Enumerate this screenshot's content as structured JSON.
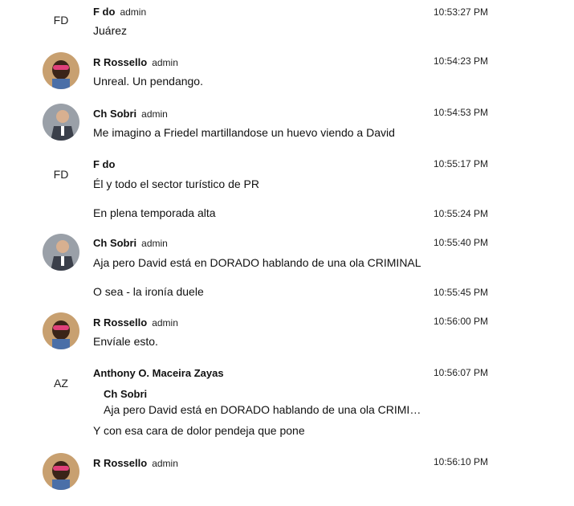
{
  "messages": [
    {
      "initials": "FD",
      "name": "F do",
      "role": "admin",
      "time": "10:53:27 PM",
      "text": "Juárez"
    },
    {
      "name": "R Rossello",
      "role": "admin",
      "time": "10:54:23 PM",
      "text": "Unreal. Un pendango."
    },
    {
      "name": "Ch Sobri",
      "role": "admin",
      "time": "10:54:53 PM",
      "text": "Me imagino a Friedel martillandose un huevo viendo a David"
    },
    {
      "initials": "FD",
      "name": "F do",
      "role": "admin",
      "time": "10:55:17 PM",
      "text": "Él y todo el sector turístico de PR"
    },
    {
      "time": "10:55:24 PM",
      "text": "En plena temporada alta"
    },
    {
      "name": "Ch Sobri",
      "role": "admin",
      "time": "10:55:40 PM",
      "text": "Aja pero David está en DORADO hablando de una ola CRIMINAL"
    },
    {
      "time": "10:55:45 PM",
      "text": "O sea - la ironía duele"
    },
    {
      "name": "R Rossello",
      "role": "admin",
      "time": "10:56:00 PM",
      "text": "Envíale esto."
    },
    {
      "initials": "AZ",
      "name": "Anthony O. Maceira Zayas",
      "time": "10:56:07 PM",
      "quote_name": "Ch Sobri",
      "quote_text": "Aja pero David está en DORADO hablando de una ola CRIMI…",
      "text": "Y con esa cara de dolor pendeja que pone"
    },
    {
      "name": "R Rossello",
      "role": "admin",
      "time": "10:56:10 PM"
    }
  ],
  "colors": {
    "avatar_rossello_bg": "#b08850",
    "avatar_sobri_bg": "#7a6a5a"
  }
}
